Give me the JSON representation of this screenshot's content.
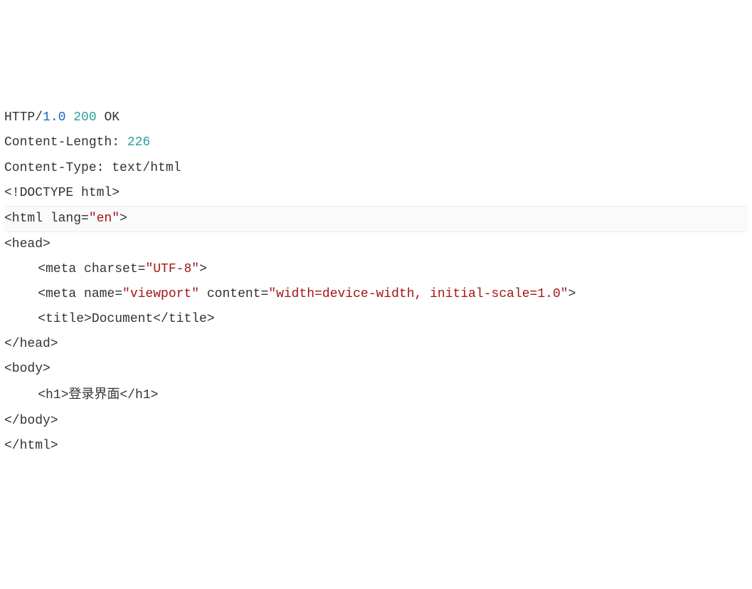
{
  "lines": {
    "l1_http": "HTTP/",
    "l1_version": "1.0",
    "l1_sp1": " ",
    "l1_status": "200",
    "l1_sp2": " ",
    "l1_ok": "OK",
    "l2_label": "Content-Length: ",
    "l2_value": "226",
    "l3": "Content-Type: text/html",
    "l4": "",
    "l5": "<!DOCTYPE html>",
    "l6_open": "<html lang=",
    "l6_val": "\"en\"",
    "l6_close": ">",
    "l7": "<head>",
    "l8_pre": "    <meta charset=",
    "l8_val": "\"UTF-8\"",
    "l8_close": ">",
    "l9_pre": "    <meta name=",
    "l9_val1": "\"viewport\"",
    "l9_mid": " content=",
    "l9_val2": "\"width=device-width, initial-scale=1.0\"",
    "l9_close": ">",
    "l10": "    <title>Document</title>",
    "l11": "</head>",
    "l12": "<body>",
    "l13_pre": "    <h1>",
    "l13_text": "登录界面",
    "l13_close": "</h1>",
    "l14": "</body>",
    "l15": "</html>"
  }
}
